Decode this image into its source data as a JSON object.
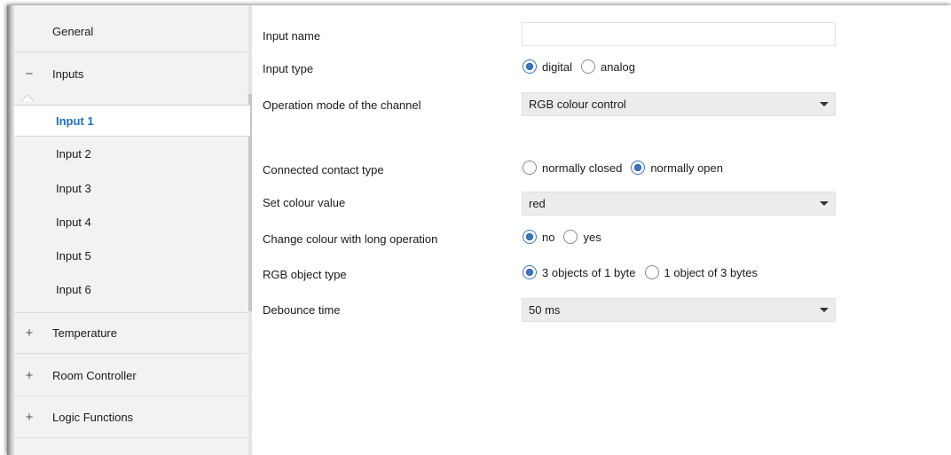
{
  "sidebar": {
    "general": "General",
    "inputs": "Inputs",
    "inputs_sign": "−",
    "sub_items": [
      "Input 1",
      "Input 2",
      "Input 3",
      "Input 4",
      "Input 5",
      "Input 6"
    ],
    "active_sub": "Input 1",
    "temperature": "Temperature",
    "room_controller": "Room Controller",
    "logic_functions": "Logic Functions",
    "expand_sign": "+"
  },
  "form": {
    "input_name": {
      "label": "Input name",
      "value": "",
      "placeholder": ""
    },
    "input_type": {
      "label": "Input type",
      "options": [
        "digital",
        "analog"
      ],
      "selected": "digital"
    },
    "operation_mode": {
      "label": "Operation mode of the channel",
      "value": "RGB colour control"
    },
    "contact_type": {
      "label": "Connected contact type",
      "options": [
        "normally closed",
        "normally open"
      ],
      "selected": "normally open"
    },
    "colour_value": {
      "label": "Set colour value",
      "value": "red"
    },
    "long_operation": {
      "label": "Change colour with long operation",
      "options": [
        "no",
        "yes"
      ],
      "selected": "no"
    },
    "rgb_object_type": {
      "label": "RGB object type",
      "options": [
        "3 objects of 1 byte",
        "1 object of 3 bytes"
      ],
      "selected": "3 objects of 1 byte"
    },
    "debounce": {
      "label": "Debounce time",
      "value": "50 ms"
    }
  },
  "colors": {
    "accent": "#1f6fbf",
    "radio_selected": "#3a78c4"
  }
}
